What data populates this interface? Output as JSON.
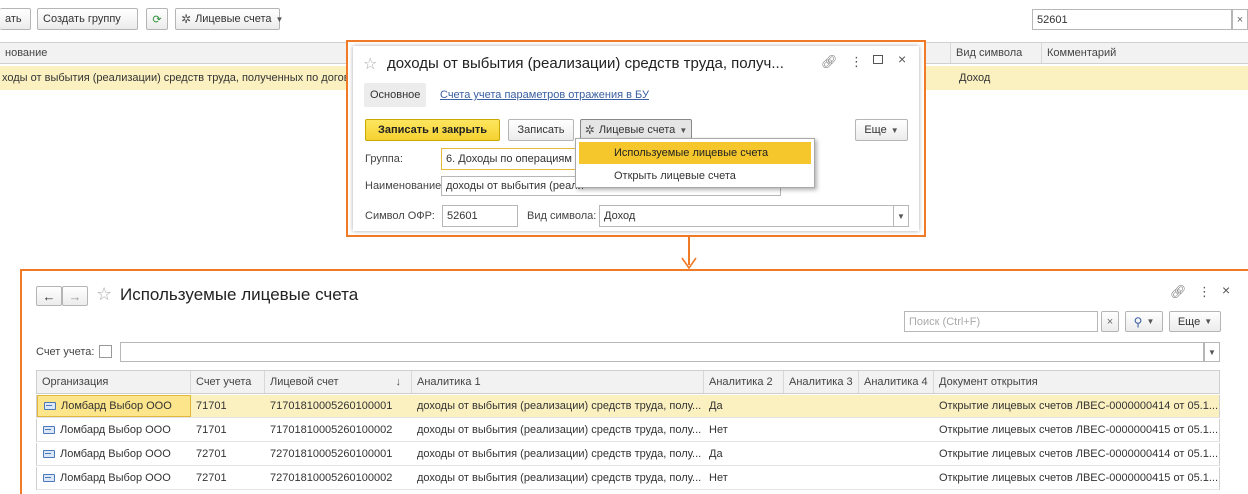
{
  "background_list": {
    "toolbar": {
      "partial_button": "ать",
      "create_group_button": "Создать группу",
      "accounts_button": "Лицевые счета",
      "search_value": "52601",
      "clear_icon": "×"
    },
    "columns": {
      "name": "нование",
      "symbol_type": "Вид символа",
      "comment": "Комментарий"
    },
    "row": {
      "name": "ходы от выбытия (реализации) средств труда, полученных по договор",
      "symbol_type": "Доход"
    }
  },
  "item_dialog": {
    "title": "доходы от выбытия (реализации) средств труда, получ...",
    "tabs": {
      "main": "Основное",
      "accounts_link": "Счета учета параметров отражения в БУ"
    },
    "toolbar": {
      "save_close": "Записать и закрыть",
      "save": "Записать",
      "accounts": "Лицевые счета",
      "more": "Еще"
    },
    "fields": {
      "group_label": "Группа:",
      "group_value": "6. Доходы по операциям с",
      "name_label": "Наименование:",
      "name_value": "доходы от выбытия (реали",
      "symbol_label": "Символ ОФР:",
      "symbol_value": "52601",
      "symbol_type_label": "Вид символа:",
      "symbol_type_value": "Доход"
    },
    "menu": {
      "item_used": "Используемые лицевые счета",
      "item_open": "Открыть лицевые счета"
    }
  },
  "accounts_window": {
    "title": "Используемые лицевые счета",
    "search_placeholder": "Поиск (Ctrl+F)",
    "more": "Еще",
    "account_label": "Счет учета:",
    "columns": {
      "org": "Организация",
      "account": "Счет учета",
      "personal": "Лицевой счет",
      "sort": "↓",
      "an1": "Аналитика 1",
      "an2": "Аналитика 2",
      "an3": "Аналитика 3",
      "an4": "Аналитика 4",
      "doc": "Документ открытия"
    },
    "rows": [
      {
        "org": "Ломбард Выбор ООО",
        "account": "71701",
        "personal": "71701810005260100001",
        "an1": "доходы от выбытия (реализации) средств труда, полу...",
        "an2": "Да",
        "doc": "Открытие лицевых счетов ЛВЕС-0000000414 от 05.1..."
      },
      {
        "org": "Ломбард Выбор ООО",
        "account": "71701",
        "personal": "71701810005260100002",
        "an1": "доходы от выбытия (реализации) средств труда, полу...",
        "an2": "Нет",
        "doc": "Открытие лицевых счетов ЛВЕС-0000000415 от 05.1..."
      },
      {
        "org": "Ломбард Выбор ООО",
        "account": "72701",
        "personal": "72701810005260100001",
        "an1": "доходы от выбытия (реализации) средств труда, полу...",
        "an2": "Да",
        "doc": "Открытие лицевых счетов ЛВЕС-0000000414 от 05.1..."
      },
      {
        "org": "Ломбард Выбор ООО",
        "account": "72701",
        "personal": "72701810005260100002",
        "an1": "доходы от выбытия (реализации) средств труда, полу...",
        "an2": "Нет",
        "doc": "Открытие лицевых счетов ЛВЕС-0000000415 от 05.1..."
      }
    ]
  },
  "colors": {
    "accent_orange": "#f07a25",
    "selection_yellow": "#fbf0c0",
    "button_yellow": "#f5d230",
    "link_blue": "#3a5fa0"
  },
  "icons": [
    "gear-icon",
    "refresh-icon",
    "star-icon",
    "link-icon",
    "kebab-icon",
    "maximize-icon",
    "close-icon",
    "back-arrow-icon",
    "forward-arrow-icon",
    "search-icon",
    "card-icon",
    "chevron-down-icon"
  ]
}
